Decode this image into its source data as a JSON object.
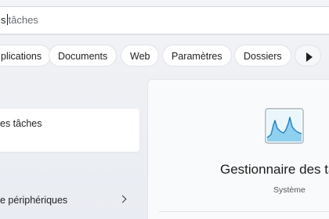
{
  "search": {
    "typed": "s",
    "suggestion": "tâches"
  },
  "filters": {
    "items": [
      {
        "label": "plications"
      },
      {
        "label": "Documents"
      },
      {
        "label": "Web"
      },
      {
        "label": "Paramètres"
      },
      {
        "label": "Dossiers"
      }
    ],
    "more_icon": "play-icon"
  },
  "results": {
    "best_match": {
      "label": "es tâches"
    },
    "list": [
      {
        "label": "e périphériques",
        "icon": "chevron-right-icon"
      }
    ]
  },
  "detail": {
    "app_name": "Gestionnaire des tâ",
    "category": "Système",
    "icon": "task-manager-icon"
  },
  "colors": {
    "accent": "#0a63c9",
    "chart_fill": "#8fd0ee",
    "chart_stroke": "#1b7fc1"
  }
}
